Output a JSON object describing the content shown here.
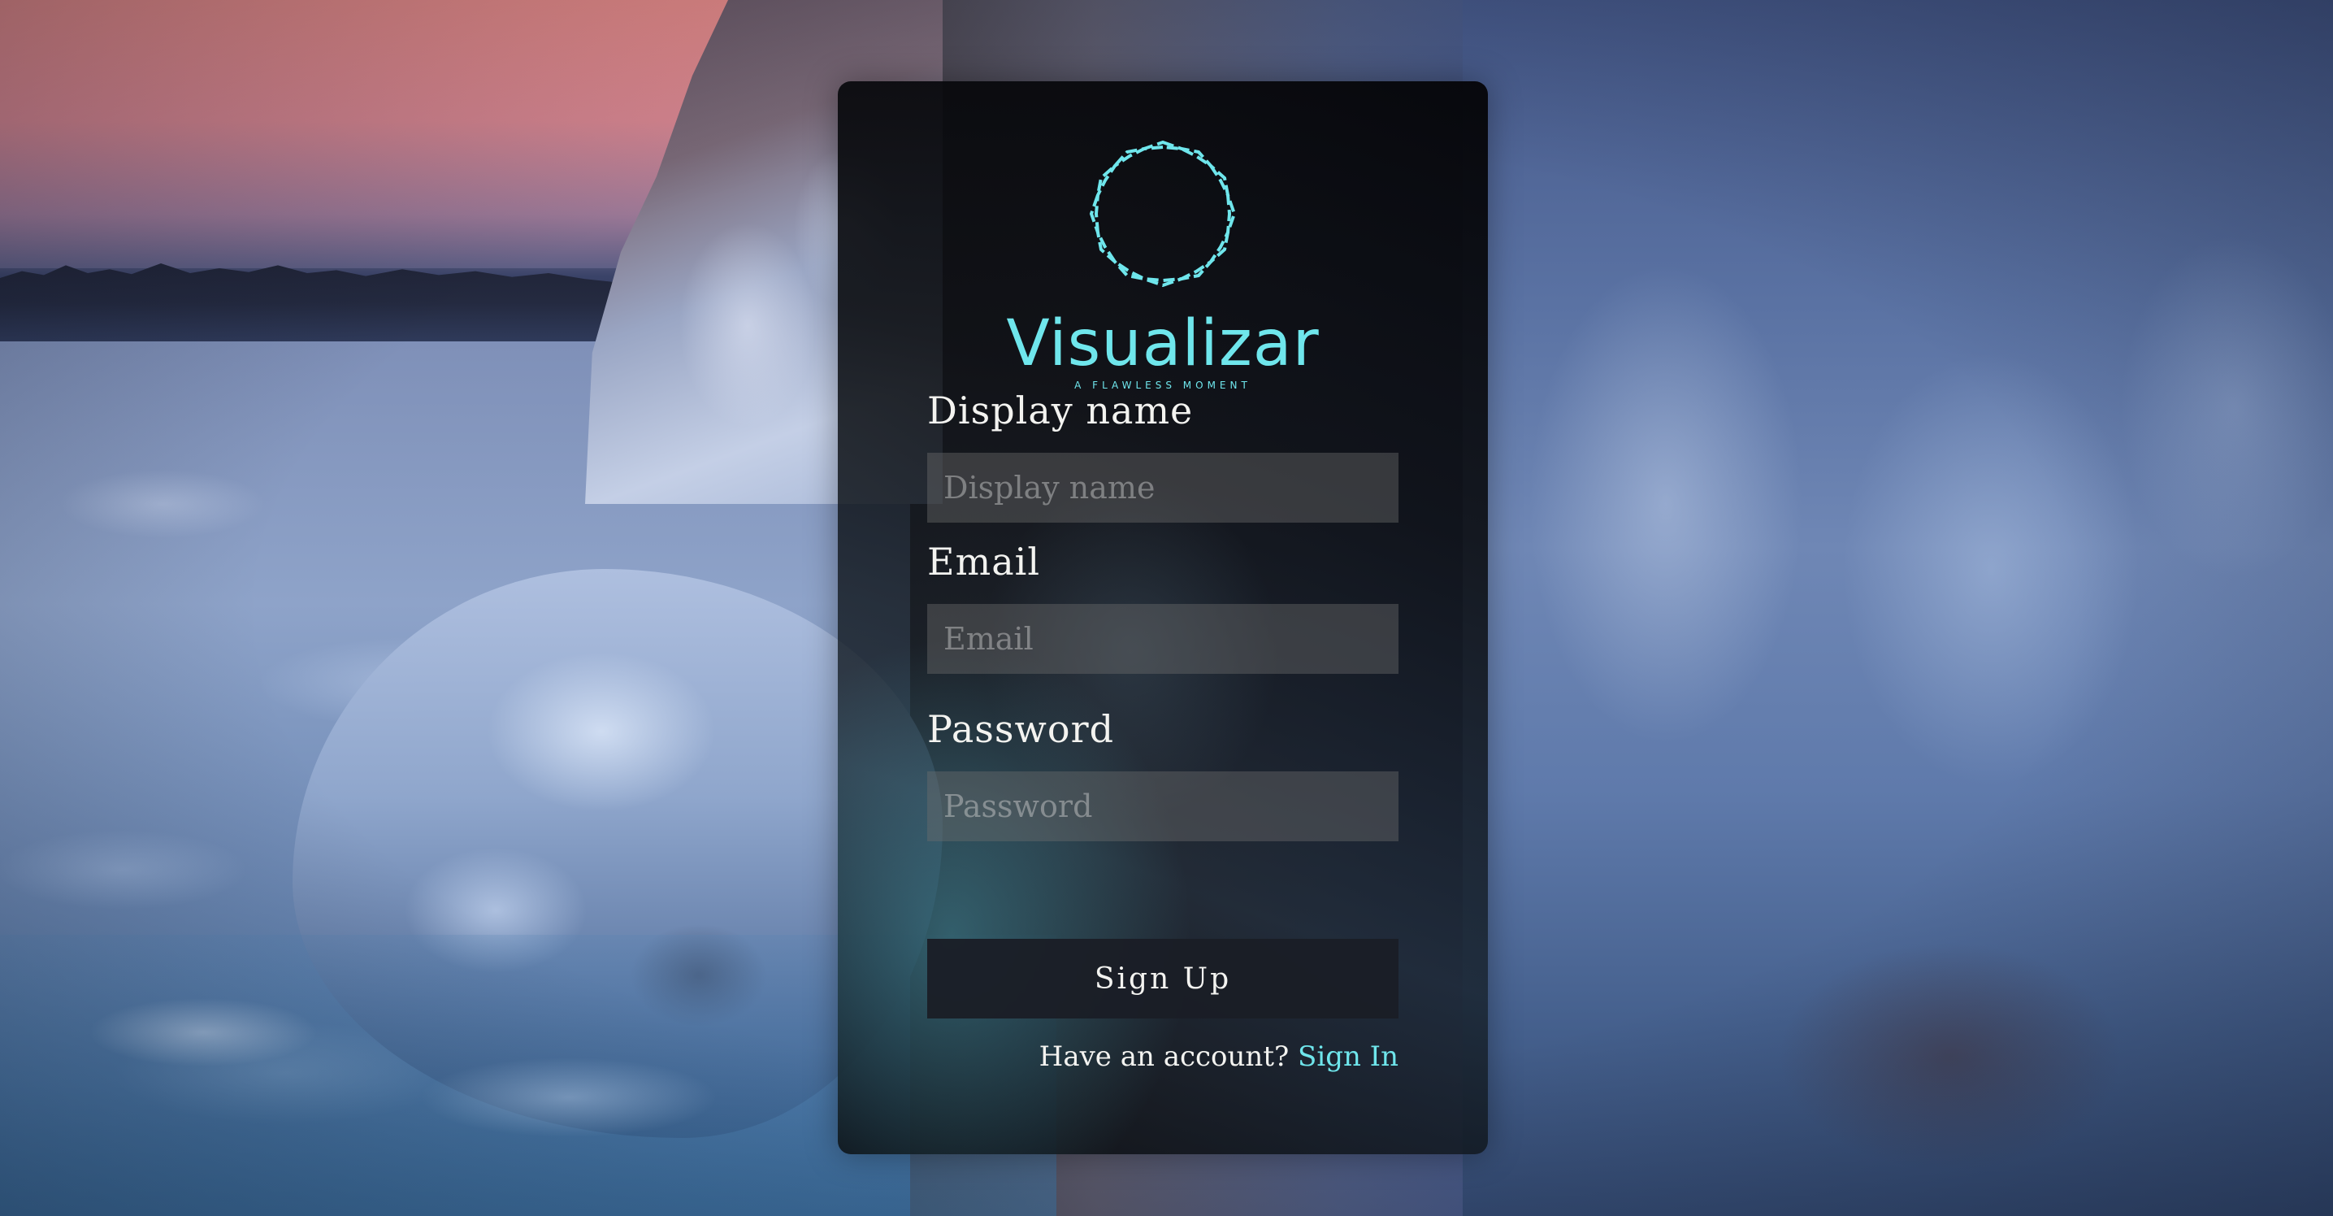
{
  "brand": {
    "name": "Visualizar",
    "tagline": "A FLAWLESS MOMENT",
    "accent_color": "#6fe6ec",
    "logo_icon": "starburst-ring-icon"
  },
  "form": {
    "display_name": {
      "label": "Display name",
      "placeholder": "Display name",
      "value": ""
    },
    "email": {
      "label": "Email",
      "placeholder": "Email",
      "value": ""
    },
    "password": {
      "label": "Password",
      "placeholder": "Password",
      "value": ""
    },
    "submit_label": "Sign Up"
  },
  "footer": {
    "prompt": "Have an account?",
    "link_label": "Sign In"
  }
}
